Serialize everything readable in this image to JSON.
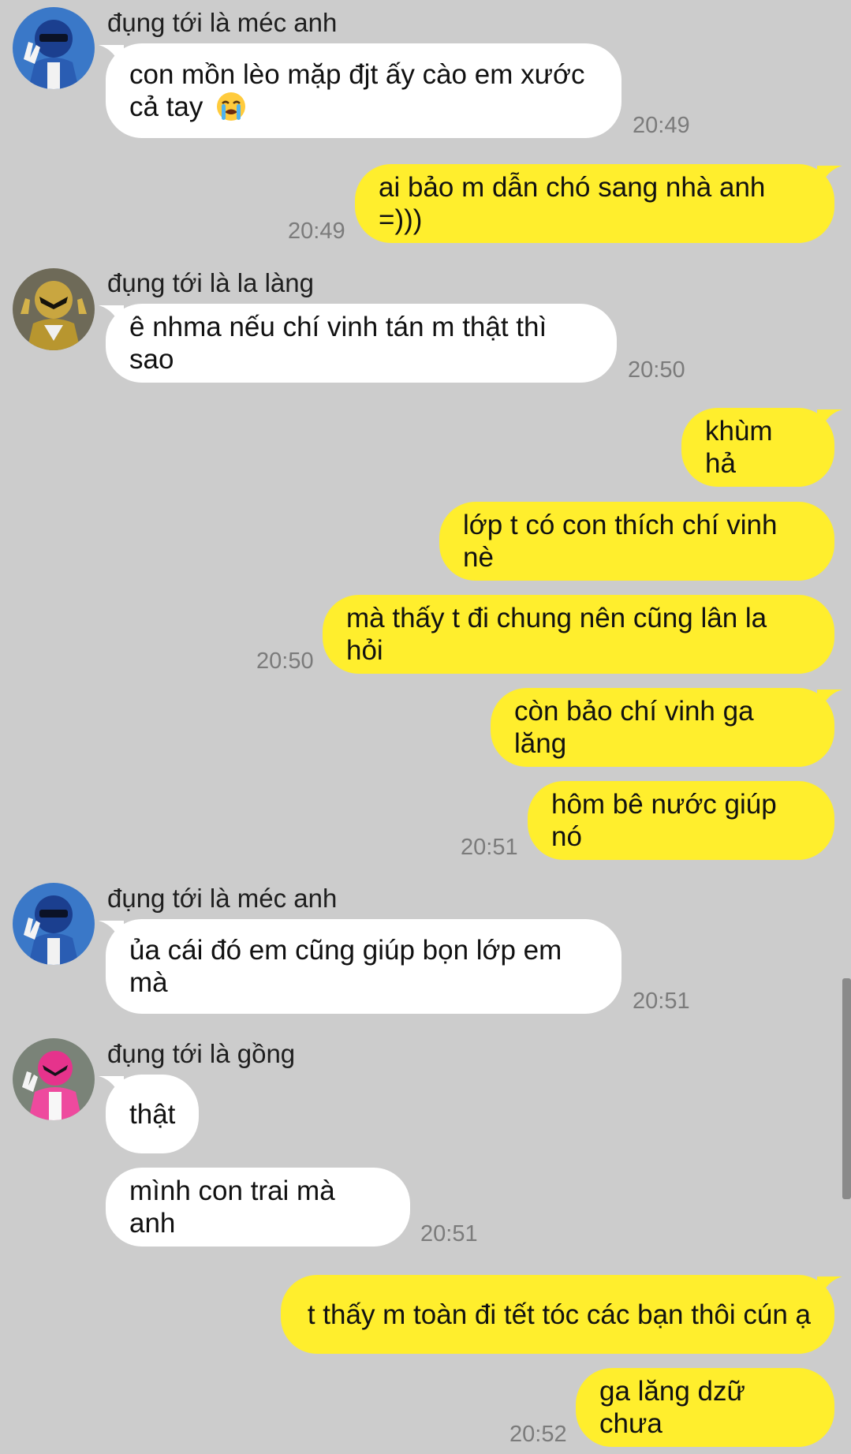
{
  "colors": {
    "background": "#cccccc",
    "incoming_bubble": "#ffffff",
    "outgoing_bubble": "#ffee2d",
    "timestamp": "#7b7b7b"
  },
  "messages": [
    {
      "sender": "đụng tới là méc anh",
      "avatar": "blue-ranger-avatar",
      "text": "con mồn lèo mặp đjt ấy cào em xước cả tay",
      "emoji": "loudly-crying-face-icon",
      "time": "20:49"
    },
    {
      "text": "ai bảo m dẫn chó sang nhà anh =)))",
      "time": "20:49"
    },
    {
      "sender": "đụng tới là la làng",
      "avatar": "yellow-ranger-avatar",
      "text": "ê nhma nếu chí vinh tán m thật thì sao",
      "time": "20:50"
    },
    {
      "text": "khùm hả"
    },
    {
      "text": "lớp t có con thích chí vinh nè"
    },
    {
      "text": "mà thấy t đi chung nên cũng lân la hỏi",
      "time": "20:50"
    },
    {
      "text": "còn bảo chí vinh ga lăng"
    },
    {
      "text": "hôm bê nước giúp nó",
      "time": "20:51"
    },
    {
      "sender": "đụng tới là méc anh",
      "avatar": "blue-ranger-avatar",
      "text": "ủa cái đó em cũng giúp bọn lớp em mà",
      "time": "20:51"
    },
    {
      "sender": "đụng tới là gồng",
      "avatar": "pink-ranger-avatar",
      "text": "thật"
    },
    {
      "text": "mình con trai mà anh",
      "time": "20:51"
    },
    {
      "text": "t thấy m toàn đi tết tóc các bạn thôi cún ạ"
    },
    {
      "text": "ga lăng dzữ chưa",
      "time": "20:52"
    }
  ]
}
